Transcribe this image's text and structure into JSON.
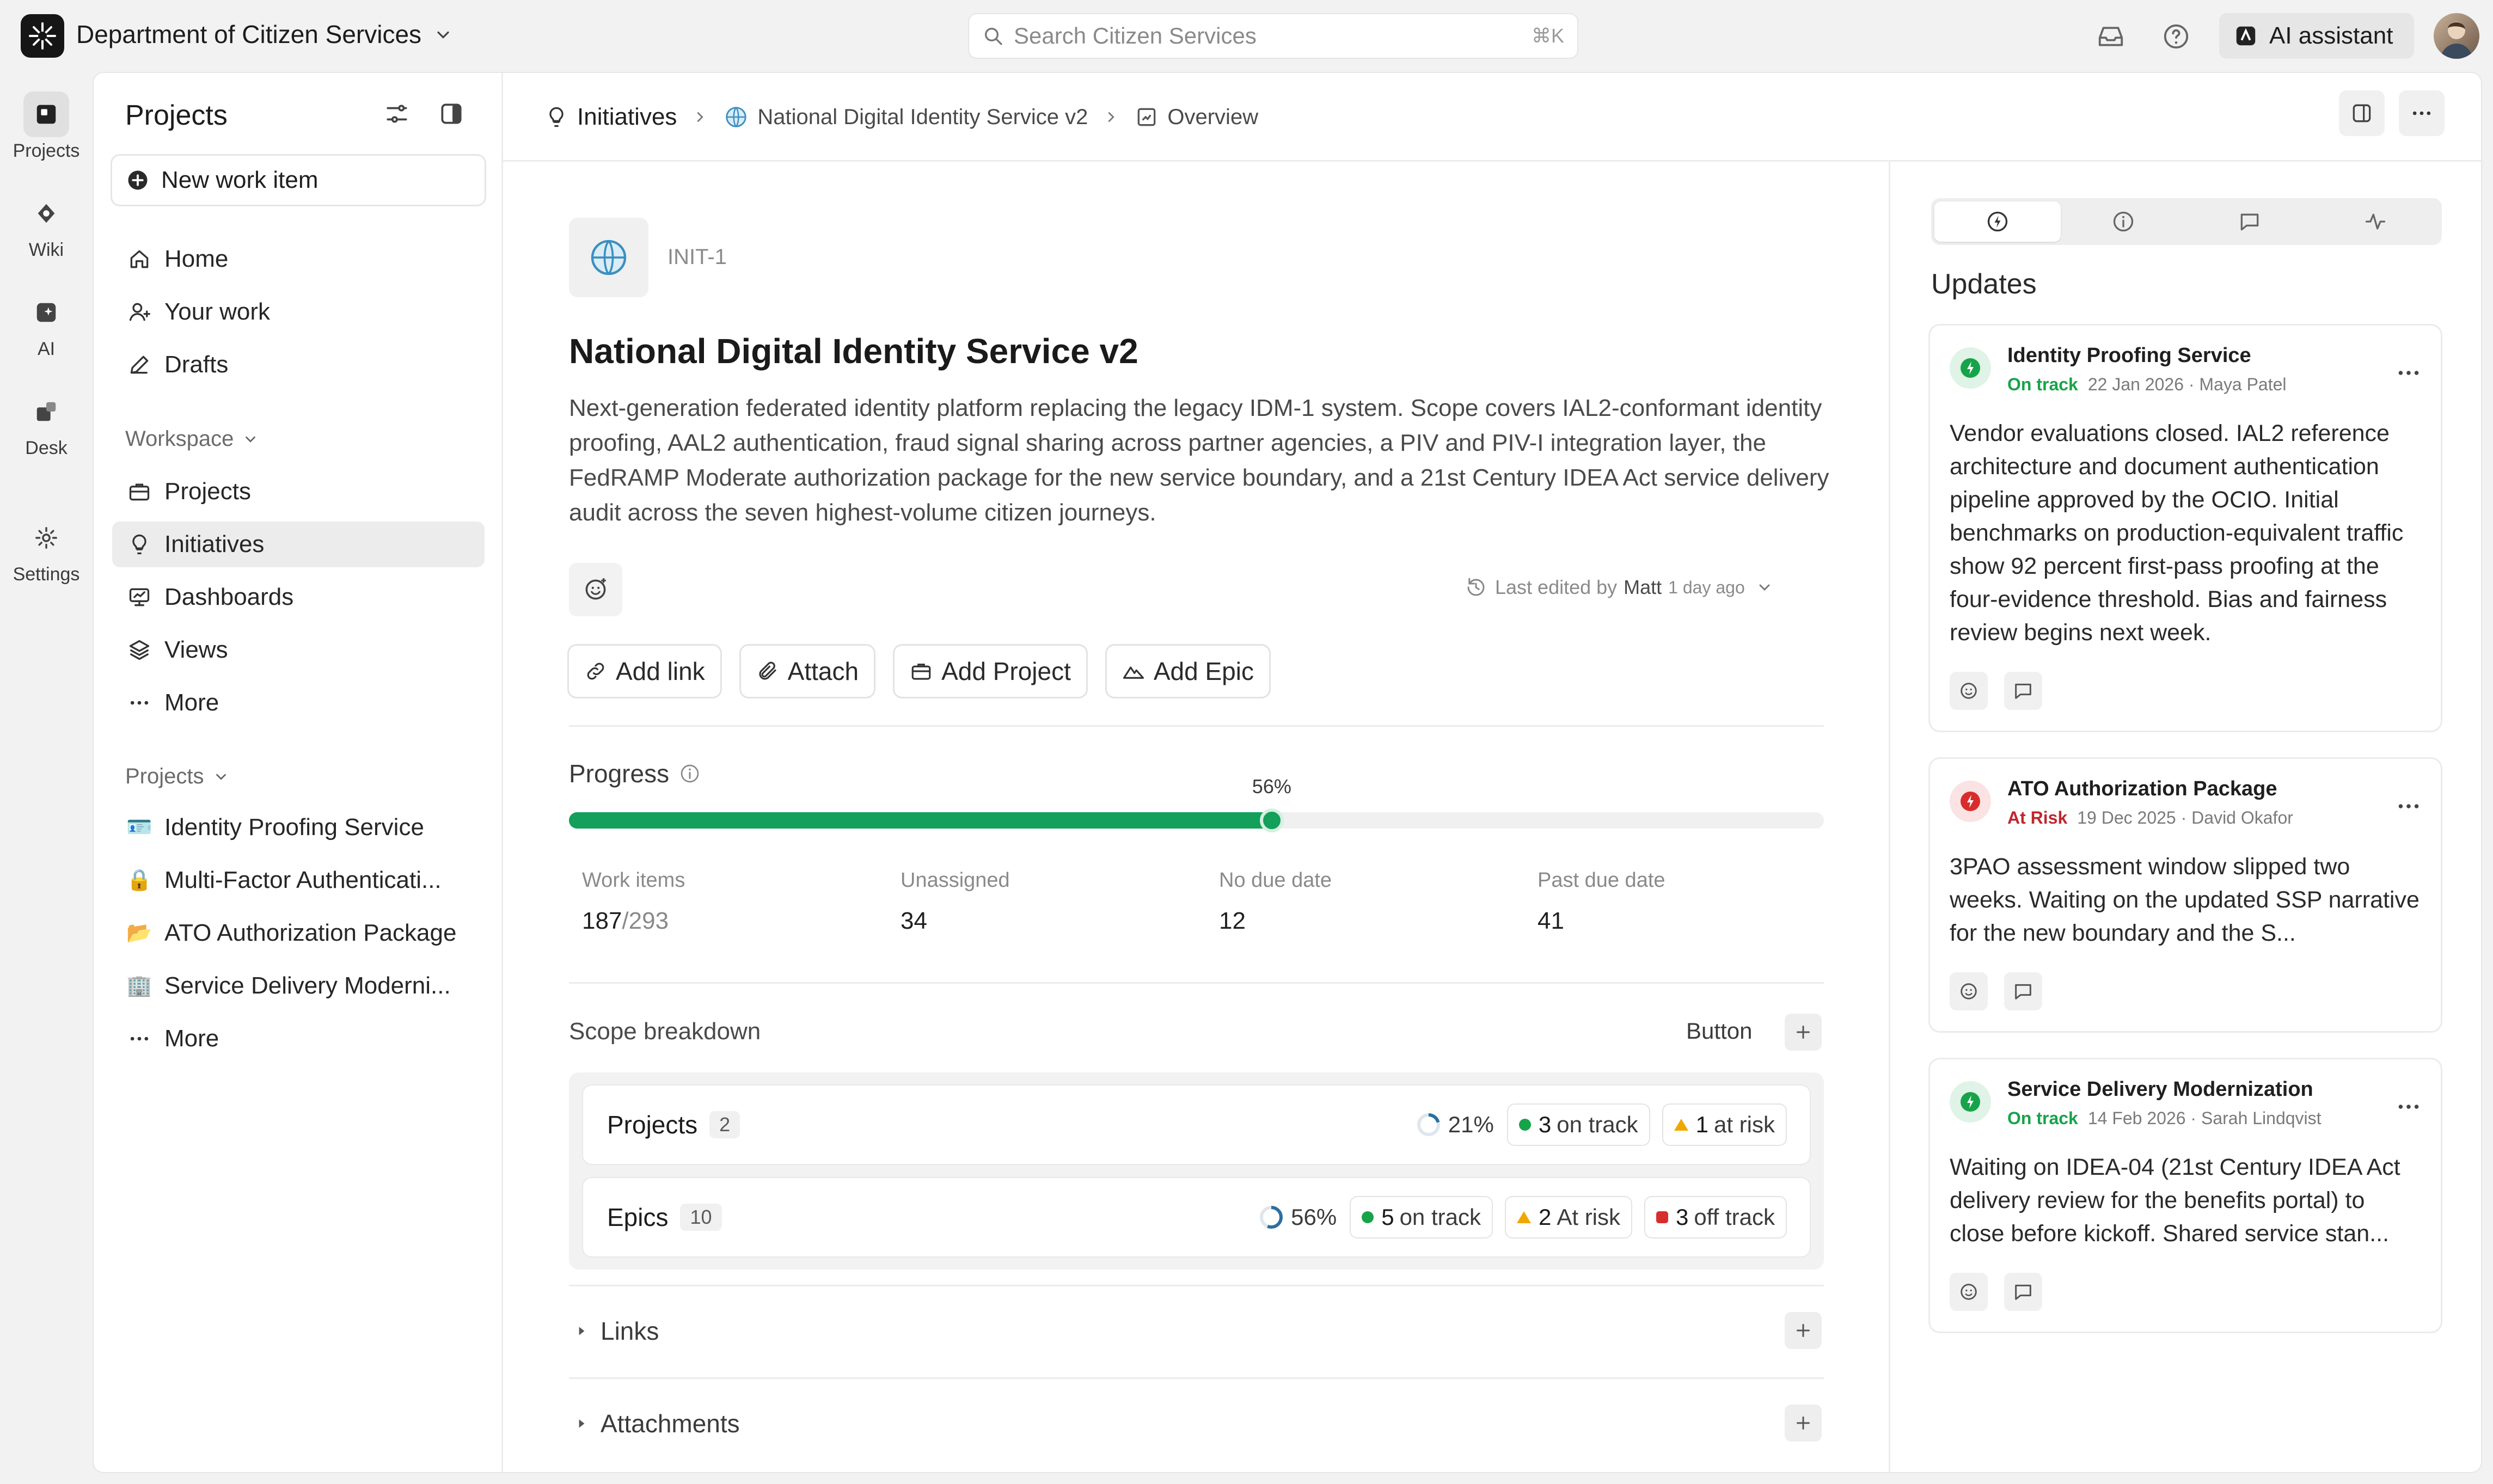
{
  "topbar": {
    "org_name": "Department of Citizen Services",
    "search_placeholder": "Search Citizen Services",
    "search_shortcut": "⌘K",
    "ai_label": "AI assistant"
  },
  "rail": [
    {
      "label": "Projects",
      "icon": "projects-icon"
    },
    {
      "label": "Wiki",
      "icon": "wiki-icon"
    },
    {
      "label": "AI",
      "icon": "ai-icon"
    },
    {
      "label": "Desk",
      "icon": "desk-icon"
    },
    {
      "label": "Settings",
      "icon": "gear-icon"
    }
  ],
  "sidebar": {
    "title": "Projects",
    "new_item": "New work item",
    "top_nav": [
      {
        "label": "Home",
        "icon": "home-icon"
      },
      {
        "label": "Your work",
        "icon": "user-icon"
      },
      {
        "label": "Drafts",
        "icon": "pencil-icon"
      }
    ],
    "workspace_label": "Workspace",
    "workspace_nav": [
      {
        "label": "Projects",
        "icon": "briefcase-icon"
      },
      {
        "label": "Initiatives",
        "icon": "lightbulb-icon"
      },
      {
        "label": "Dashboards",
        "icon": "dashboard-icon"
      },
      {
        "label": "Views",
        "icon": "layers-icon"
      },
      {
        "label": "More",
        "icon": "more-icon"
      }
    ],
    "projects_label": "Projects",
    "projects_nav": [
      {
        "label": "Identity Proofing Service",
        "emoji": "🪪"
      },
      {
        "label": "Multi-Factor Authenticati...",
        "emoji": "🔒"
      },
      {
        "label": "ATO Authorization Package",
        "emoji": "📂"
      },
      {
        "label": "Service Delivery Moderni...",
        "emoji": "🏢"
      },
      {
        "label": "More",
        "icon": "more-icon"
      }
    ]
  },
  "breadcrumb": {
    "root": "Initiatives",
    "initiative": "National Digital Identity Service v2",
    "page": "Overview"
  },
  "initiative": {
    "id": "INIT-1",
    "title": "National Digital Identity Service v2",
    "description": "Next-generation federated identity platform replacing the legacy IDM-1 system. Scope covers IAL2-conformant identity proofing, AAL2 authentication, fraud signal sharing across partner agencies, a PIV and PIV-I integration layer, the FedRAMP Moderate authorization package for the new service boundary, and a 21st Century IDEA Act service delivery audit across the seven highest-volume citizen journeys.",
    "edited_prefix": "Last edited by",
    "edited_by": "Matt",
    "edited_when": "1 day ago"
  },
  "actions": [
    {
      "label": "Add link",
      "icon": "link-icon"
    },
    {
      "label": "Attach",
      "icon": "paperclip-icon"
    },
    {
      "label": "Add Project",
      "icon": "briefcase-icon"
    },
    {
      "label": "Add Epic",
      "icon": "mountain-icon"
    }
  ],
  "progress": {
    "label": "Progress",
    "percent_label": "56%",
    "fraction": 0.56,
    "stats": [
      {
        "label": "Work items",
        "value": "187",
        "total": "/293"
      },
      {
        "label": "Unassigned",
        "value": "34"
      },
      {
        "label": "No due date",
        "value": "12"
      },
      {
        "label": "Past due date",
        "value": "41"
      }
    ]
  },
  "scope": {
    "label": "Scope breakdown",
    "button": "Button",
    "rows": [
      {
        "name": "Projects",
        "count": "2",
        "pct": "21%",
        "pct_fraction": 0.21,
        "chips": [
          {
            "n": "3",
            "text": "on track",
            "kind": "dot",
            "color": "#17a34a"
          },
          {
            "n": "1",
            "text": "at risk",
            "kind": "tri",
            "color": "#f0a800"
          }
        ]
      },
      {
        "name": "Epics",
        "count": "10",
        "pct": "56%",
        "pct_fraction": 0.56,
        "chips": [
          {
            "n": "5",
            "text": "on track",
            "kind": "dot",
            "color": "#17a34a"
          },
          {
            "n": "2",
            "text": "At risk",
            "kind": "tri",
            "color": "#f0a800"
          },
          {
            "n": "3",
            "text": "off track",
            "kind": "sqr",
            "color": "#d92d2d"
          }
        ]
      }
    ]
  },
  "sections": {
    "links": "Links",
    "attachments": "Attachments"
  },
  "updates": {
    "title": "Updates",
    "items": [
      {
        "name": "Identity Proofing Service",
        "status": "On track",
        "status_color": "#17a34a",
        "badge_color": "#17a34a",
        "date": "22 Jan 2026",
        "author": "Maya Patel",
        "text": "Vendor evaluations closed. IAL2 reference architecture and document authentication pipeline approved by the OCIO. Initial benchmarks on production-equivalent traffic show 92 percent first-pass proofing at the four-evidence threshold. Bias and fairness review begins next week."
      },
      {
        "name": "ATO Authorization Package",
        "status": "At Risk",
        "status_color": "#c0262d",
        "badge_color": "#d92d2d",
        "date": "19 Dec 2025",
        "author": "David Okafor",
        "text": "3PAO assessment window slipped two weeks. Waiting on the updated SSP narrative for the new boundary and the S..."
      },
      {
        "name": "Service Delivery Modernization",
        "status": "On track",
        "status_color": "#17a34a",
        "badge_color": "#17a34a",
        "date": "14 Feb 2026",
        "author": "Sarah Lindqvist",
        "text": "Waiting on IDEA-04 (21st Century IDEA Act delivery review for the benefits portal) to close before kickoff. Shared service stan..."
      }
    ]
  }
}
